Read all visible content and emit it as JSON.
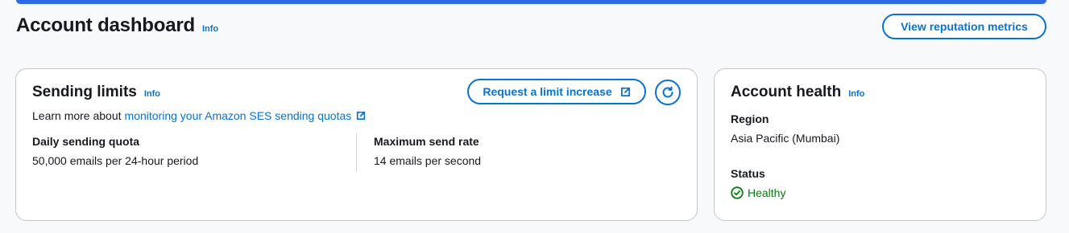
{
  "header": {
    "title": "Account dashboard",
    "info_label": "Info",
    "reputation_button": "View reputation metrics"
  },
  "sending_limits": {
    "title": "Sending limits",
    "info_label": "Info",
    "request_button": "Request a limit increase",
    "learn_prefix": "Learn more about",
    "learn_link": "monitoring your Amazon SES sending quotas",
    "daily_quota_label": "Daily sending quota",
    "daily_quota_value": "50,000 emails per 24-hour period",
    "max_rate_label": "Maximum send rate",
    "max_rate_value": "14 emails per second"
  },
  "account_health": {
    "title": "Account health",
    "info_label": "Info",
    "region_label": "Region",
    "region_value": "Asia Pacific (Mumbai)",
    "status_label": "Status",
    "status_value": "Healthy"
  },
  "colors": {
    "accent": "#0972d3",
    "top_bar": "#2f6be0",
    "success": "#037f0c"
  },
  "icons": [
    "external-link-icon",
    "refresh-icon",
    "check-circle-icon"
  ]
}
